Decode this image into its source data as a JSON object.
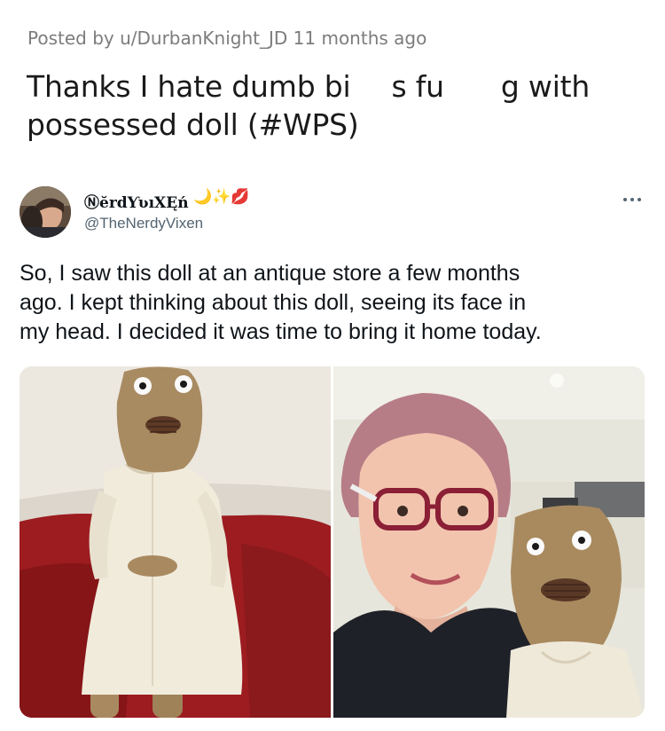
{
  "post": {
    "meta": "Posted by u/DurbanKnight_JD 11 months ago",
    "title_line1_a": "Thanks I hate dumb bi",
    "title_line1_b": "s fu",
    "title_line1_c": "g with",
    "title_line2": "possessed doll (#WPS)"
  },
  "tweet": {
    "display_name": "ⓃĕrdƳʋıXĘń",
    "emojis": "🌙✨💋",
    "handle": "@TheNerdyVixen",
    "text_line1": "So, I saw this doll at an antique store a few months",
    "text_line2": "ago. I kept thinking about this doll, seeing its face in",
    "text_line3": "my head. I decided it was time to bring it home today.",
    "more_icon": "more-horizontal-icon"
  },
  "photos": [
    {
      "name": "doll-on-couch-photo"
    },
    {
      "name": "selfie-with-doll-photo"
    }
  ]
}
